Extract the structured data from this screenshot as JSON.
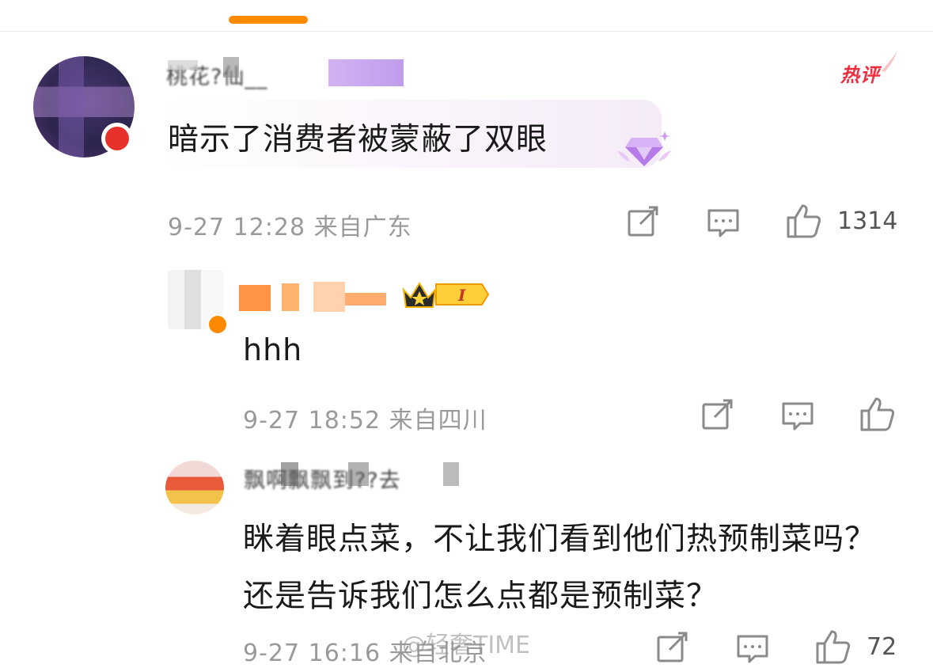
{
  "colors": {
    "accent_orange": "#ff8a00",
    "hot_red": "#ef2d3e",
    "meta_gray": "#9a9a9a",
    "text_dark": "#1a1a1a"
  },
  "comments": [
    {
      "username": "桃花?仙__",
      "username_obscured": true,
      "badge": "热评",
      "text": "暗示了消费者被蒙蔽了双眼",
      "meta": "9-27 12:28 来自广东",
      "like_count": "1314",
      "icons": [
        "repost-icon",
        "comment-icon",
        "like-icon"
      ]
    },
    {
      "username": "",
      "username_obscured": true,
      "level_badge": "I",
      "text": "hhh",
      "meta": "9-27 18:52 来自四川",
      "like_count": "",
      "icons": [
        "repost-icon",
        "comment-icon",
        "like-icon"
      ]
    },
    {
      "username": "飘啊飘飘到??去",
      "username_obscured": true,
      "text": "眯着眼点菜，不让我们看到他们热预制菜吗？还是告诉我们怎么点都是预制菜？",
      "meta": "9-27 16:16 来自北京",
      "like_count": "72",
      "icons": [
        "repost-icon",
        "comment-icon",
        "like-icon"
      ]
    }
  ],
  "watermark": "@轻奢ТIME"
}
